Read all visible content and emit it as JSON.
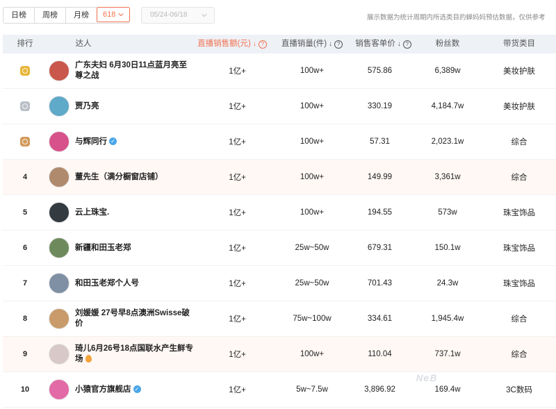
{
  "toolbar": {
    "tabs": [
      {
        "label": "日榜",
        "active": false
      },
      {
        "label": "周榜",
        "active": false
      },
      {
        "label": "月榜",
        "active": false
      },
      {
        "label": "618",
        "active": true
      }
    ],
    "date_range": "05/24-06/18",
    "notice": "展示数据为统计周期内所选类目的蝉妈妈预估数据，仅供参考"
  },
  "table": {
    "headers": {
      "rank": "排行",
      "talent": "达人",
      "amount": "直播销售额(元)",
      "volume": "直播销量(件)",
      "price": "销售客单价",
      "fans": "粉丝数",
      "category": "带货类目"
    },
    "rows": [
      {
        "rank": "",
        "medal": "gold",
        "name": "广东夫妇 6月30日11点蓝月亮至尊之战",
        "badge": "",
        "amount": "1亿+",
        "volume": "100w+",
        "price": "575.86",
        "fans": "6,389w",
        "category": "美妆护肤"
      },
      {
        "rank": "",
        "medal": "silver",
        "name": "贾乃亮",
        "badge": "",
        "amount": "1亿+",
        "volume": "100w+",
        "price": "330.19",
        "fans": "4,184.7w",
        "category": "美妆护肤"
      },
      {
        "rank": "",
        "medal": "bronze",
        "name": "与辉同行",
        "badge": "verified",
        "amount": "1亿+",
        "volume": "100w+",
        "price": "57.31",
        "fans": "2,023.1w",
        "category": "综合"
      },
      {
        "rank": "4",
        "medal": "",
        "name": "董先生（满分橱窗店铺）",
        "badge": "",
        "amount": "1亿+",
        "volume": "100w+",
        "price": "149.99",
        "fans": "3,361w",
        "category": "综合"
      },
      {
        "rank": "5",
        "medal": "",
        "name": "云上珠宝.",
        "badge": "",
        "amount": "1亿+",
        "volume": "100w+",
        "price": "194.55",
        "fans": "573w",
        "category": "珠宝饰品"
      },
      {
        "rank": "6",
        "medal": "",
        "name": "新疆和田玉老郑",
        "badge": "",
        "amount": "1亿+",
        "volume": "25w~50w",
        "price": "679.31",
        "fans": "150.1w",
        "category": "珠宝饰品"
      },
      {
        "rank": "7",
        "medal": "",
        "name": "和田玉老郑个人号",
        "badge": "",
        "amount": "1亿+",
        "volume": "25w~50w",
        "price": "701.43",
        "fans": "24.3w",
        "category": "珠宝饰品"
      },
      {
        "rank": "8",
        "medal": "",
        "name": "刘媛媛 27号早8点澳洲Swisse破价",
        "badge": "",
        "amount": "1亿+",
        "volume": "75w~100w",
        "price": "334.61",
        "fans": "1,945.4w",
        "category": "综合"
      },
      {
        "rank": "9",
        "medal": "",
        "name": "琦儿6月26号18点国联水产生鲜专场",
        "badge": "flame",
        "amount": "1亿+",
        "volume": "100w+",
        "price": "110.04",
        "fans": "737.1w",
        "category": "综合"
      },
      {
        "rank": "10",
        "medal": "",
        "name": "小猿官方旗舰店",
        "badge": "verified",
        "amount": "1亿+",
        "volume": "5w~7.5w",
        "price": "3,896.92",
        "fans": "169.4w",
        "category": "3C数码"
      }
    ]
  },
  "colors": {
    "accent": "#f2704f",
    "gold": "#e8b53a",
    "silver": "#b9bfc6",
    "bronze": "#d39a5b",
    "header_bg": "#eef1f6",
    "shaded_row": "#fff8f5"
  }
}
